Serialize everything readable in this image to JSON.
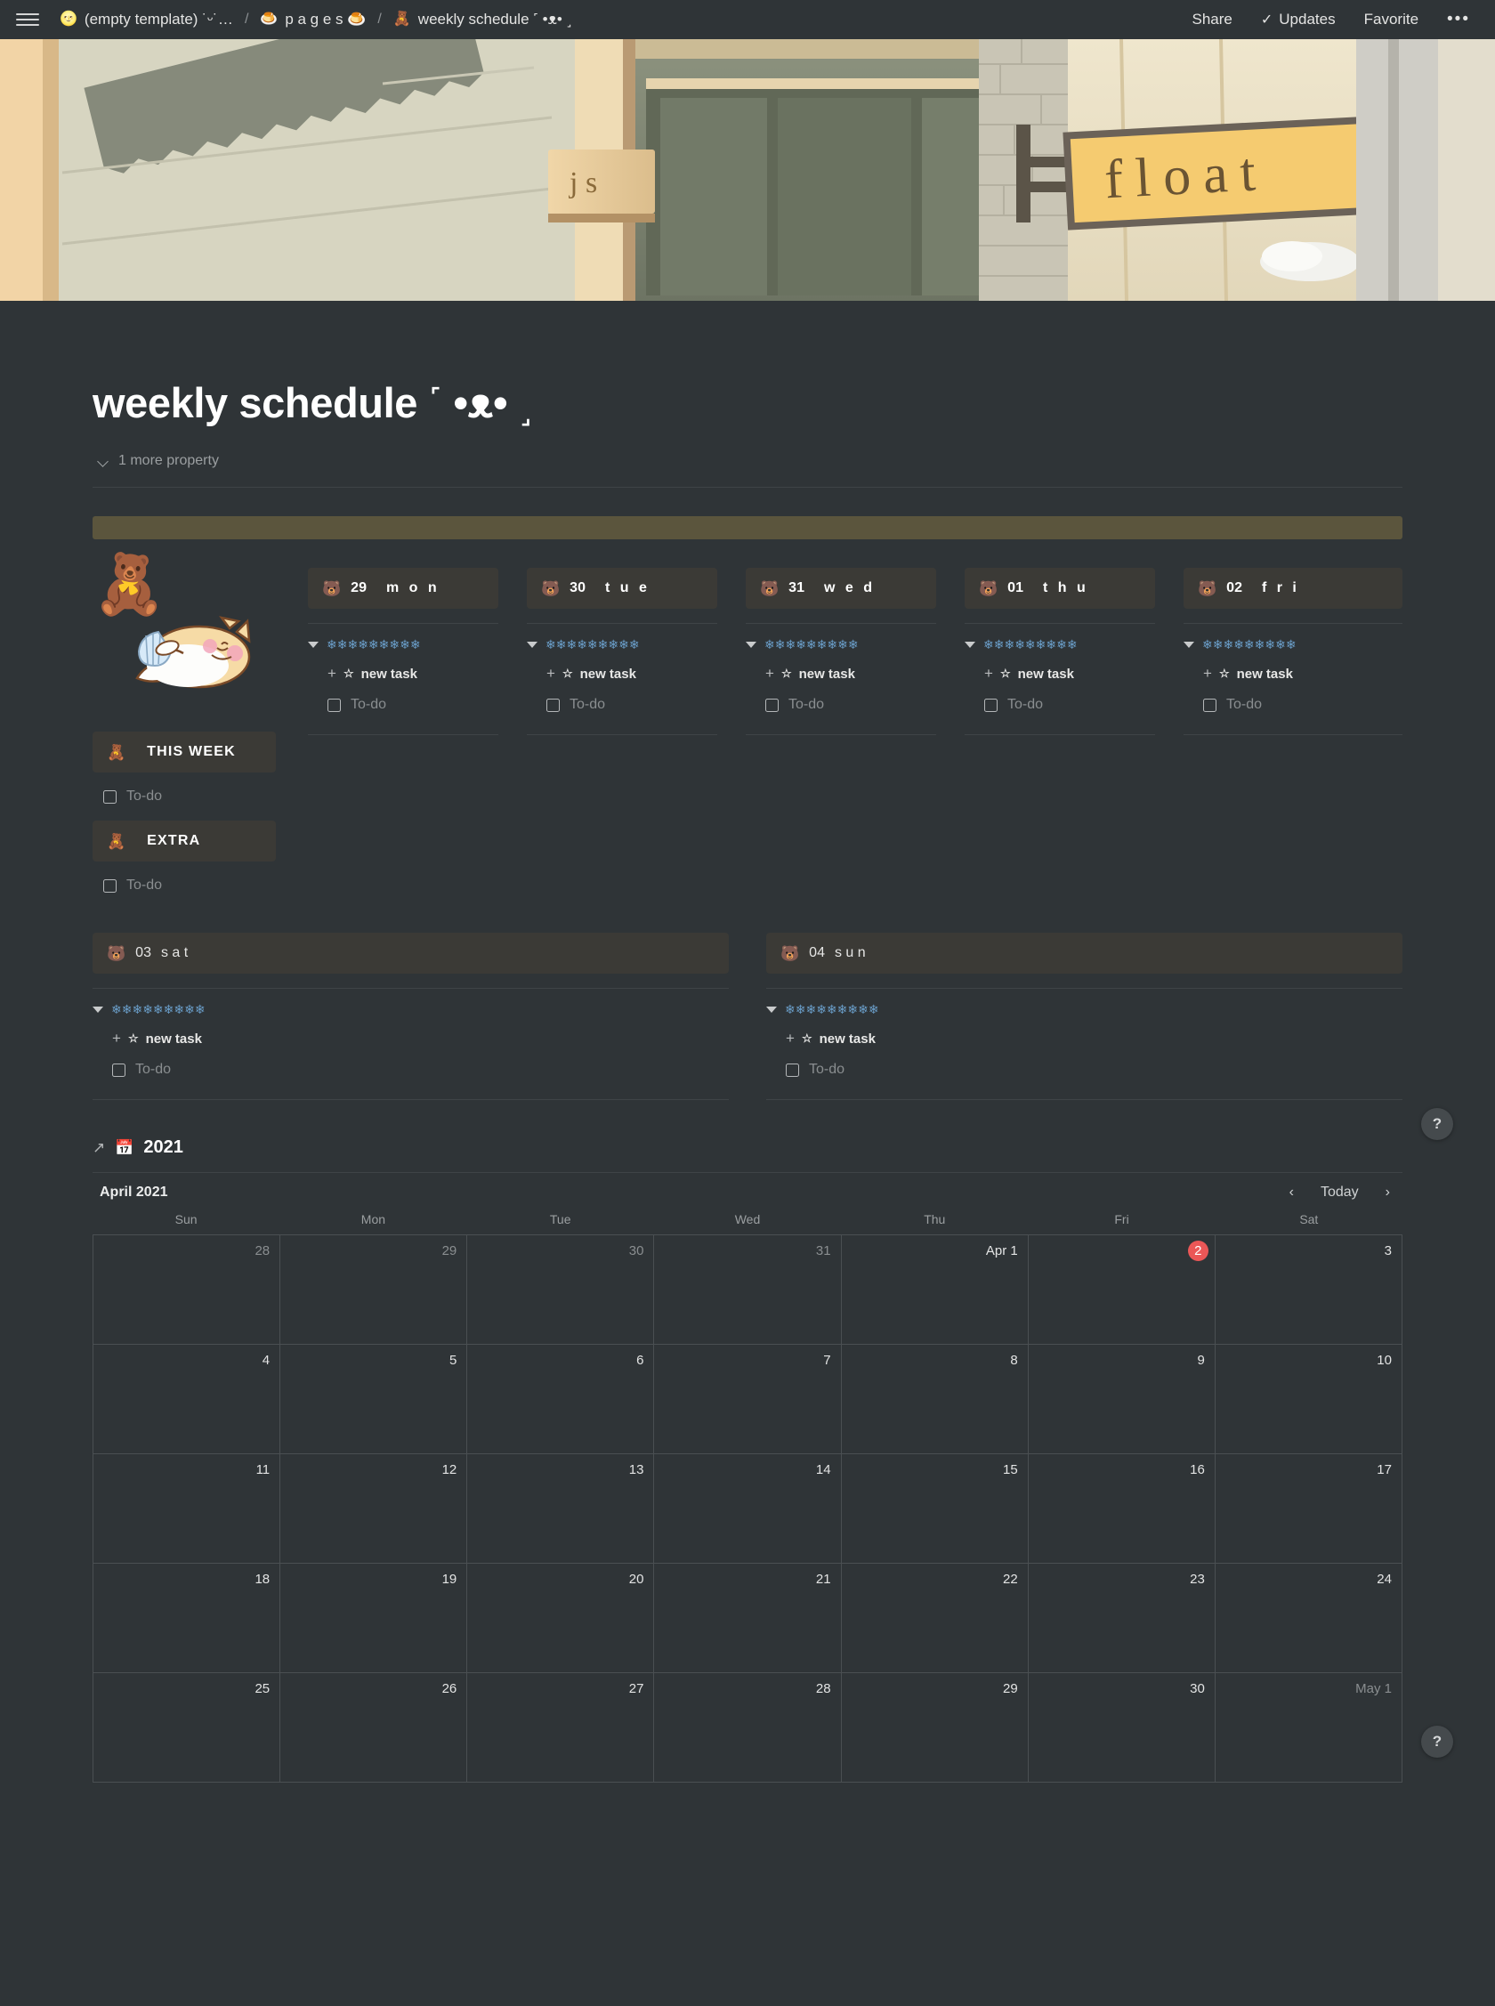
{
  "topbar": {
    "menu_icon": "hamburger-icon",
    "breadcrumb": [
      {
        "emoji": "🌝",
        "label": "(empty template) ˙ᵕ˙…"
      },
      {
        "emoji": "🍮",
        "label": "p a g e s 🍮"
      },
      {
        "emoji": "🧸",
        "label": "weekly schedule ˹ •ᴥ• ˼"
      }
    ],
    "separator": "/",
    "share_label": "Share",
    "updates_label": "Updates",
    "updates_icon": "check-icon",
    "favorite_label": "Favorite",
    "more_label": "•••"
  },
  "cover": {
    "sign_text": "float",
    "small_sign_text": "j s"
  },
  "page": {
    "icon": "🧸",
    "title": "weekly schedule ˹ •ᴥ• ˼",
    "more_properties_label": "1 more property",
    "chevron_icon": "chevron-down-icon",
    "callout_color": "#5b553d"
  },
  "week": {
    "task_add_label": "new task",
    "task_add_star": "☆",
    "task_add_plus": "+",
    "todo_label": "To-do",
    "snowflakes": "❄❄❄❄❄❄❄❄❄",
    "day_emoji": "🐻",
    "days": [
      {
        "num": "29",
        "name": "m o n"
      },
      {
        "num": "30",
        "name": "t u e"
      },
      {
        "num": "31",
        "name": "w e d"
      },
      {
        "num": "01",
        "name": "t h u"
      },
      {
        "num": "02",
        "name": "f r i"
      }
    ],
    "weekend": [
      {
        "num": "03",
        "name": "s a t"
      },
      {
        "num": "04",
        "name": "s u n"
      }
    ]
  },
  "sidebar_sections": [
    {
      "emoji": "🧸",
      "label": "THIS WEEK",
      "todo_label": "To-do"
    },
    {
      "emoji": "🧸",
      "label": "EXTRA",
      "todo_label": "To-do"
    }
  ],
  "calendar": {
    "link_arrow": "↗",
    "link_emoji": "📅",
    "link_title": "2021",
    "month_label": "April 2021",
    "prev_icon": "chevron-left-icon",
    "next_icon": "chevron-right-icon",
    "today_label": "Today",
    "weekday_headers": [
      "Sun",
      "Mon",
      "Tue",
      "Wed",
      "Thu",
      "Fri",
      "Sat"
    ],
    "today_color": "#eb5757",
    "weeks": [
      [
        {
          "label": "28",
          "muted": true,
          "today": false
        },
        {
          "label": "29",
          "muted": true,
          "today": false
        },
        {
          "label": "30",
          "muted": true,
          "today": false
        },
        {
          "label": "31",
          "muted": true,
          "today": false
        },
        {
          "label": "Apr 1",
          "muted": false,
          "today": false
        },
        {
          "label": "2",
          "muted": false,
          "today": true
        },
        {
          "label": "3",
          "muted": false,
          "today": false
        }
      ],
      [
        {
          "label": "4",
          "muted": false,
          "today": false
        },
        {
          "label": "5",
          "muted": false,
          "today": false
        },
        {
          "label": "6",
          "muted": false,
          "today": false
        },
        {
          "label": "7",
          "muted": false,
          "today": false
        },
        {
          "label": "8",
          "muted": false,
          "today": false
        },
        {
          "label": "9",
          "muted": false,
          "today": false
        },
        {
          "label": "10",
          "muted": false,
          "today": false
        }
      ],
      [
        {
          "label": "11",
          "muted": false,
          "today": false
        },
        {
          "label": "12",
          "muted": false,
          "today": false
        },
        {
          "label": "13",
          "muted": false,
          "today": false
        },
        {
          "label": "14",
          "muted": false,
          "today": false
        },
        {
          "label": "15",
          "muted": false,
          "today": false
        },
        {
          "label": "16",
          "muted": false,
          "today": false
        },
        {
          "label": "17",
          "muted": false,
          "today": false
        }
      ],
      [
        {
          "label": "18",
          "muted": false,
          "today": false
        },
        {
          "label": "19",
          "muted": false,
          "today": false
        },
        {
          "label": "20",
          "muted": false,
          "today": false
        },
        {
          "label": "21",
          "muted": false,
          "today": false
        },
        {
          "label": "22",
          "muted": false,
          "today": false
        },
        {
          "label": "23",
          "muted": false,
          "today": false
        },
        {
          "label": "24",
          "muted": false,
          "today": false
        }
      ],
      [
        {
          "label": "25",
          "muted": false,
          "today": false
        },
        {
          "label": "26",
          "muted": false,
          "today": false
        },
        {
          "label": "27",
          "muted": false,
          "today": false
        },
        {
          "label": "28",
          "muted": false,
          "today": false
        },
        {
          "label": "29",
          "muted": false,
          "today": false
        },
        {
          "label": "30",
          "muted": false,
          "today": false
        },
        {
          "label": "May 1",
          "muted": true,
          "today": false
        }
      ]
    ]
  },
  "help_button_label": "?"
}
